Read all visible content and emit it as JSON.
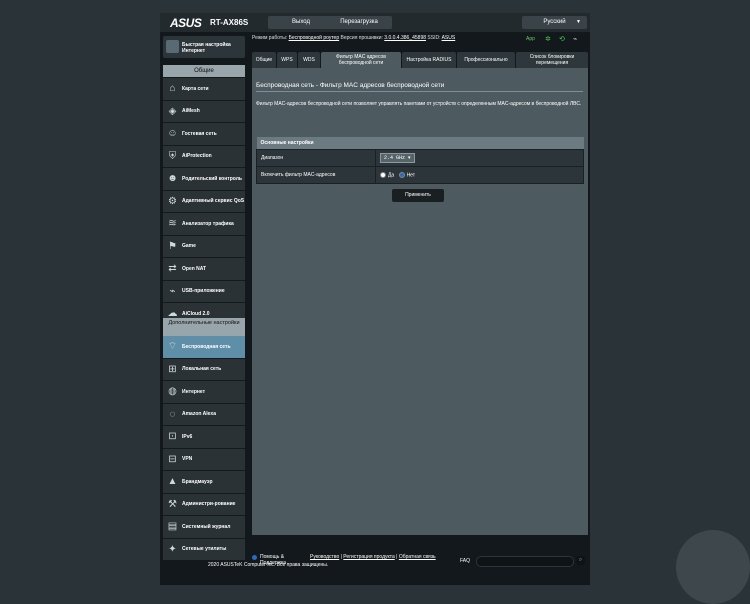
{
  "header": {
    "brand": "ASUS",
    "model": "RT-AX86S",
    "logout": "Выход",
    "reboot": "Перезагрузка",
    "language": "Русский"
  },
  "status": {
    "mode_label": "Режим работы:",
    "mode_value": "Беспроводной роутер",
    "fw_label": "Версия прошивки:",
    "fw_value": "3.0.0.4.386_45898",
    "ssid_label": "SSID:",
    "ssid_value": "ASUS",
    "app_label": "App"
  },
  "sidebar": {
    "quick_setup": "Быстрая настройка Интернет",
    "general_title": "Общие",
    "general_items": [
      {
        "label": "Карта сети",
        "icon": "network-map"
      },
      {
        "label": "AiMesh",
        "icon": "aimesh"
      },
      {
        "label": "Гостевая сеть",
        "icon": "guest"
      },
      {
        "label": "AiProtection",
        "icon": "shield"
      },
      {
        "label": "Родительский контроль",
        "icon": "parental"
      },
      {
        "label": "Адаптивный сервис QoS",
        "icon": "qos"
      },
      {
        "label": "Анализатор трафика",
        "icon": "traffic"
      },
      {
        "label": "Game",
        "icon": "game"
      },
      {
        "label": "Open NAT",
        "icon": "nat"
      },
      {
        "label": "USB-приложение",
        "icon": "usb"
      },
      {
        "label": "AiCloud 2.0",
        "icon": "cloud"
      }
    ],
    "advanced_title": "Дополнительные настройки",
    "advanced_items": [
      {
        "label": "Беспроводная сеть",
        "icon": "wireless",
        "active": true
      },
      {
        "label": "Локальная сеть",
        "icon": "lan"
      },
      {
        "label": "Интернет",
        "icon": "globe"
      },
      {
        "label": "Amazon Alexa",
        "icon": "alexa"
      },
      {
        "label": "IPv6",
        "icon": "ipv6"
      },
      {
        "label": "VPN",
        "icon": "vpn"
      },
      {
        "label": "Брандмауэр",
        "icon": "firewall"
      },
      {
        "label": "Администри-рование",
        "icon": "admin"
      },
      {
        "label": "Системный журнал",
        "icon": "log"
      },
      {
        "label": "Сетевые утилиты",
        "icon": "tools"
      }
    ]
  },
  "tabs": [
    {
      "label": "Общие"
    },
    {
      "label": "WPS"
    },
    {
      "label": "WDS"
    },
    {
      "label": "Фильтр MAC адресов беспроводной сети",
      "active": true
    },
    {
      "label": "Настройка RADIUS"
    },
    {
      "label": "Профессионально"
    },
    {
      "label": "Список блокировки перемещения"
    }
  ],
  "content": {
    "title": "Беспроводная сеть - Фильтр MAC адресов беспроводной сети",
    "description": "Фильтр MAC-адресов беспроводной сети позволяет управлять пакетами от устройств с определенным MAC-адресом в беспроводной ЛВС.",
    "section_title": "Основные настройки",
    "band_label": "Диапазон",
    "band_value": "2.4 GHz",
    "filter_label": "Включить фильтр MAC-адресов",
    "yes_label": "Да",
    "no_label": "Нет",
    "apply": "Применить"
  },
  "footer": {
    "help": "Помощь & Поддержка",
    "manual": "Руководство",
    "register": "Регистрация продукта",
    "feedback": "Обратная связь",
    "faq": "FAQ",
    "copyright": "2020 ASUSTeK Computer Inc. Все права защищены."
  }
}
